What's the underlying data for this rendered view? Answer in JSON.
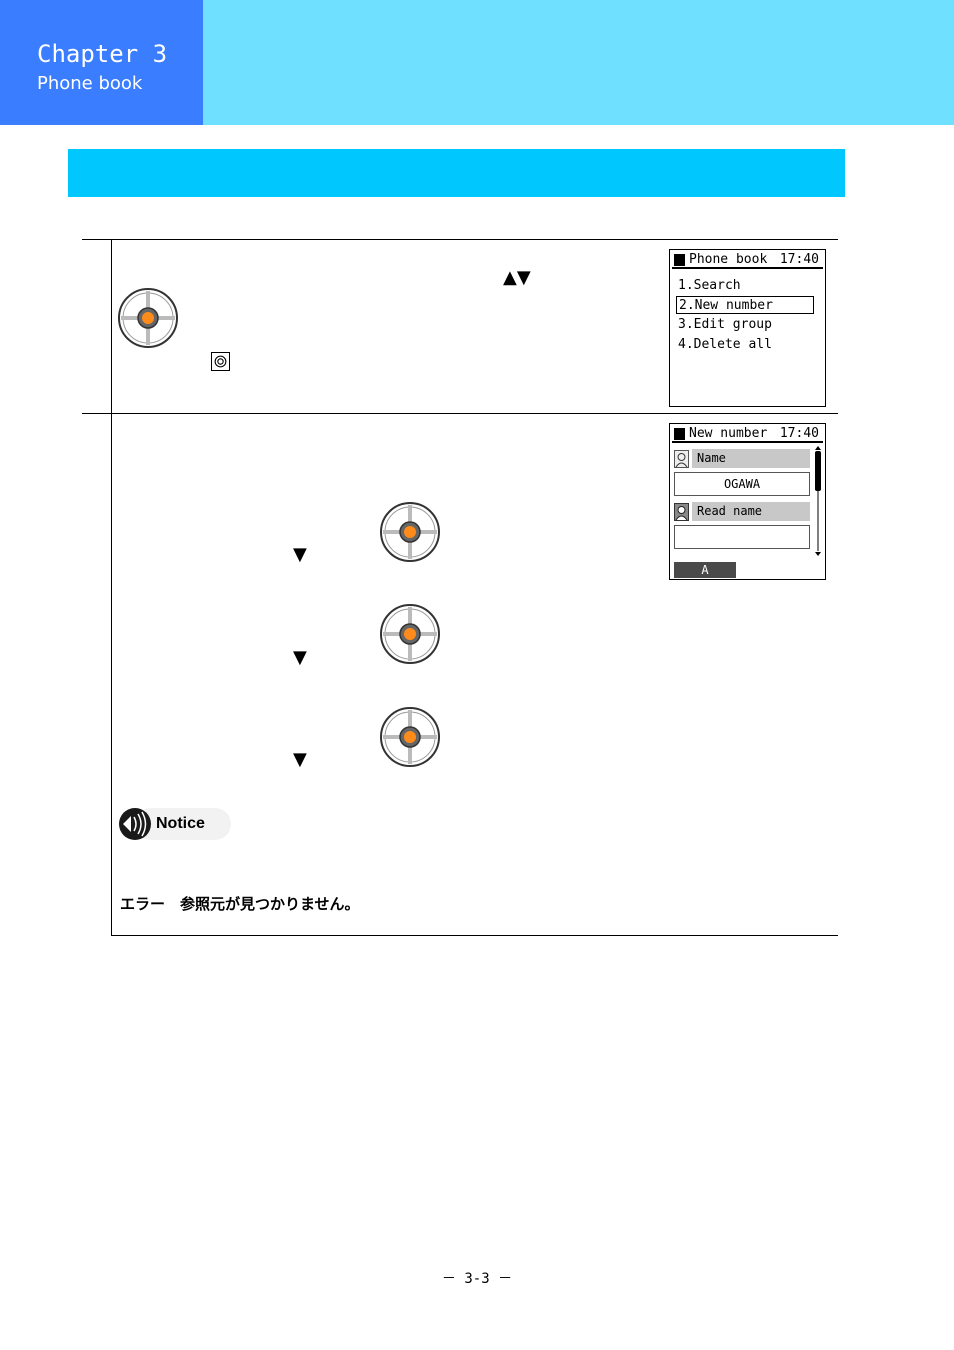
{
  "header": {
    "chapter_title": "Chapter 3",
    "chapter_subtitle": "Phone book",
    "colors": {
      "band": "#6fe0ff",
      "chapter_box": "#3a7dff",
      "section_bar": "#00c8ff"
    }
  },
  "step1": {
    "arrow_keys": "▲▼",
    "screen": {
      "title": "Phone book",
      "time": "17:40",
      "menu": [
        {
          "label": "1.Search",
          "selected": false
        },
        {
          "label": "2.New number",
          "selected": true
        },
        {
          "label": "3.Edit group",
          "selected": false
        },
        {
          "label": "4.Delete all",
          "selected": false
        }
      ]
    }
  },
  "step2": {
    "down_arrows": [
      "▼",
      "▼",
      "▼"
    ],
    "screen": {
      "title": "New number",
      "time": "17:40",
      "name_label": "Name",
      "name_value": "OGAWA",
      "read_name_label": "Read name",
      "read_name_value": "",
      "input_mode": "A"
    }
  },
  "notice": {
    "label": "Notice"
  },
  "error_text": "エラー　参照元が見つかりません。",
  "footer": {
    "page_number": "－ 3-3 －"
  },
  "icons": [
    "dpad-icon",
    "select-key-icon",
    "notice-icon",
    "person-icon",
    "scroll-arrow-icon"
  ]
}
